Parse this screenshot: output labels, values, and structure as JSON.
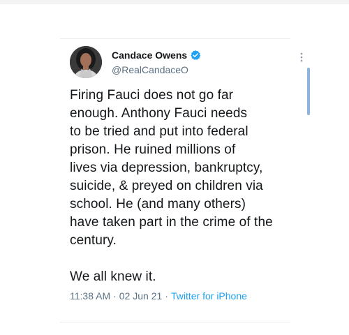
{
  "tweet": {
    "author": {
      "display_name": "Candace Owens",
      "handle": "@RealCandaceO",
      "verified": true
    },
    "text": "Firing Fauci does not go far\nenough. Anthony Fauci needs\nto be tried and put into federal\nprison. He ruined millions of\nlives via depression, bankruptcy,\nsuicide, & preyed on children via\nschool. He (and many others)\nhave taken part in the crime of the\ncentury.\n\nWe all knew it.",
    "time": "11:38 AM",
    "separator1": "·",
    "date": "02 Jun 21",
    "separator2": "·",
    "source": "Twitter for iPhone"
  },
  "colors": {
    "background": "#f3f3f3",
    "card": "#ffffff",
    "text": "#14171a",
    "secondary": "#5b7083",
    "accent": "#1da1f2"
  },
  "icons": {
    "verified": "verified-badge-icon",
    "more": "more-options-icon"
  }
}
